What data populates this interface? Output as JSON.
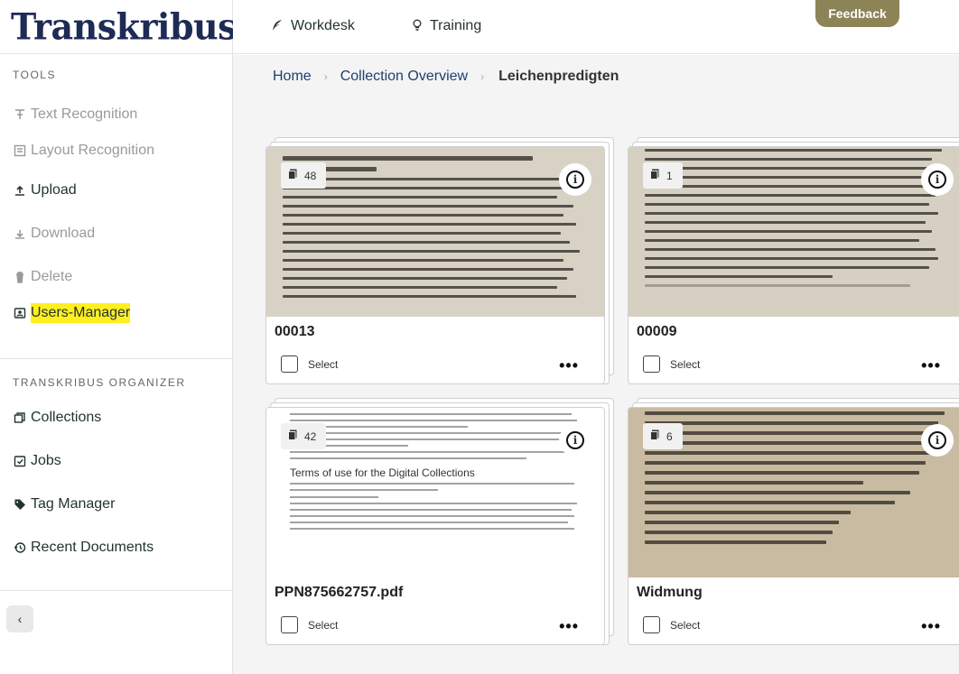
{
  "brand": {
    "logo_text": "Transkribus",
    "logo_mark": "®"
  },
  "topbar": {
    "workdesk": "Workdesk",
    "training": "Training",
    "feedback": "Feedback"
  },
  "sidebar": {
    "tools_title": "TOOLS",
    "tools": [
      {
        "label": "Text Recognition",
        "icon": "text-recognition-icon",
        "disabled": true
      },
      {
        "label": "Layout Recognition",
        "icon": "layout-recognition-icon",
        "disabled": true
      },
      {
        "label": "Upload",
        "icon": "upload-icon",
        "disabled": false
      },
      {
        "label": "Download",
        "icon": "download-icon",
        "disabled": true
      },
      {
        "label": "Delete",
        "icon": "delete-icon",
        "disabled": true
      },
      {
        "label": "Users-Manager",
        "icon": "users-manager-icon",
        "disabled": false,
        "highlighted": true
      }
    ],
    "organizer_title": "TRANSKRIBUS ORGANIZER",
    "organizer": [
      {
        "label": "Collections",
        "icon": "collections-icon"
      },
      {
        "label": "Jobs",
        "icon": "jobs-icon"
      },
      {
        "label": "Tag Manager",
        "icon": "tag-icon"
      },
      {
        "label": "Recent Documents",
        "icon": "history-icon"
      }
    ],
    "collapse_icon": "chevron-left-icon"
  },
  "breadcrumb": {
    "home": "Home",
    "collection_overview": "Collection Overview",
    "current": "Leichenpredigten"
  },
  "documents": [
    {
      "title": "00013",
      "pages": "48",
      "thumb": "scan",
      "select_label": "Select"
    },
    {
      "title": "00009",
      "pages": "1",
      "thumb": "scan",
      "select_label": "Select"
    },
    {
      "title": "PPN875662757.pdf",
      "pages": "42",
      "thumb": "doc",
      "select_label": "Select"
    },
    {
      "title": "Widmung",
      "pages": "6",
      "thumb": "scan2",
      "select_label": "Select"
    }
  ],
  "doc_preview": {
    "heading": "Terms of use for the Digital Collections"
  },
  "colors": {
    "brand_navy": "#1e2b55",
    "feedback_bg": "#8c8456",
    "highlight": "#ffef1e",
    "link": "#1d3f6e"
  }
}
